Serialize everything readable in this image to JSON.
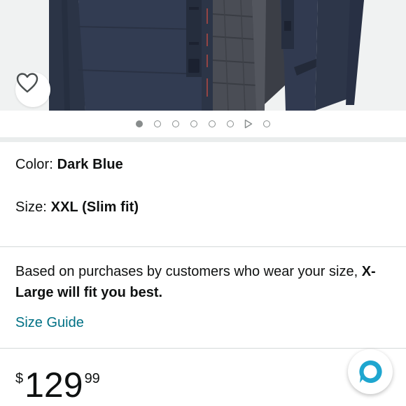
{
  "product_image": {
    "description": "product-photo-dark-blue-parka",
    "wishlist_icon": "heart-outline-icon"
  },
  "carousel": {
    "indicators": [
      "image",
      "image",
      "image",
      "image",
      "image",
      "image",
      "video",
      "image"
    ],
    "active_index": 0
  },
  "variation": {
    "color_label": "Color:",
    "color_value": "Dark Blue",
    "size_label": "Size:",
    "size_value": "XXL (Slim fit)"
  },
  "fit_recommendation": {
    "text_prefix": "Based on purchases by customers who wear your size,",
    "text_bold": "X-Large will fit you best."
  },
  "size_guide": {
    "label": "Size Guide"
  },
  "price": {
    "symbol": "$",
    "whole": "129",
    "fraction": "99"
  },
  "assistant_button": {
    "icon": "alexa-ring-icon"
  },
  "colors": {
    "link": "#007185",
    "alexa": "#1ea6cf",
    "text": "#0f1111"
  }
}
